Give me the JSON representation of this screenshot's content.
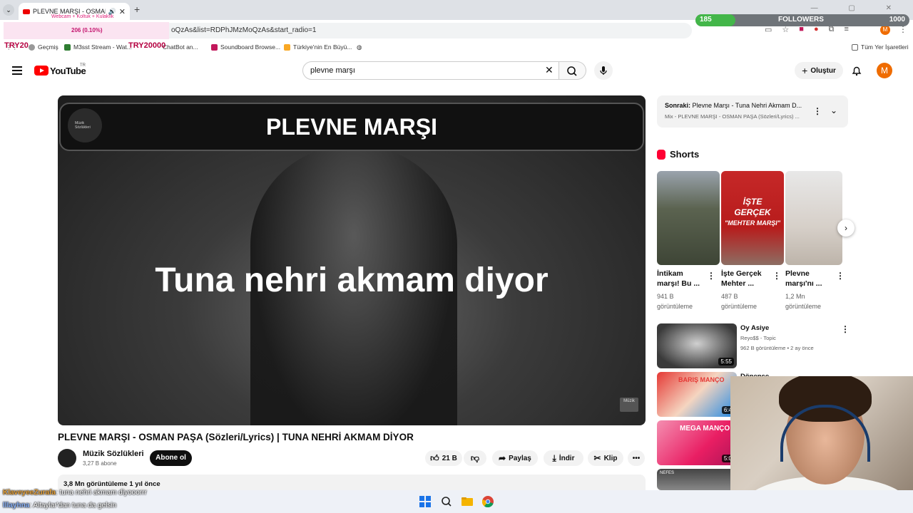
{
  "browser": {
    "tab_title": "PLEVNE MARŞI - OSMAN P",
    "url_fragment": "oQzAs&list=RDPhJMzMoQzAs&start_radio=1",
    "bookmarks": [
      {
        "label": "Geçmiş",
        "color": "#888888"
      },
      {
        "label": "M3sst Stream - Wat...",
        "color": "#2e7d32"
      },
      {
        "label": "ChatBot an...",
        "color": "#d32f2f"
      },
      {
        "label": "Soundboard Browse...",
        "color": "#c2185b"
      },
      {
        "label": "Türkiye'nin En Büyü...",
        "color": "#f9a825"
      }
    ],
    "bookmarks_right": "Tüm Yer İşaretleri",
    "window_controls": "— ▢ ✕"
  },
  "overlay": {
    "webcam_line": "Webcam + Koltuk + Kulaklık",
    "webcam_pct": "206 (0.10%)",
    "try1": "TRY20",
    "try2": "TRY20000",
    "followers_current": "185",
    "followers_label": "FOLLOWERS",
    "followers_goal": "1000",
    "followers_progress": 0.185
  },
  "header": {
    "logo_text": "YouTube",
    "logo_country": "TR",
    "search_value": "plevne marşı",
    "create_label": "Oluştur",
    "avatar_letter": "M"
  },
  "video": {
    "overlay_title": "PLEVNE MARŞI",
    "lyric": "Tuna nehri akmam diyor",
    "badge": "Müzik Sözlükleri",
    "watermark": "Müzik",
    "title": "PLEVNE MARŞI - OSMAN PAŞA (Sözleri/Lyrics) | TUNA NEHRİ AKMAM DİYOR",
    "channel": "Müzik Sözlükleri",
    "subscribers": "3,27 B abone",
    "subscribe_label": "Abone ol",
    "likes": "21 B",
    "share_label": "Paylaş",
    "download_label": "İndir",
    "clip_label": "Klip",
    "stats": "3,8 Mn görüntüleme  1 yıl önce"
  },
  "sidebar": {
    "up_next_prefix": "Sonraki:",
    "up_next_title": "Plevne Marşı - Tuna Nehri Akmam D...",
    "up_next_sub": "Mix - PLEVNE MARŞI - OSMAN PAŞA (Sözleri/Lyrics) ...",
    "shorts_heading": "Shorts",
    "shorts": [
      {
        "title": "İntikam marşı! Bu ...",
        "views": "941 B görüntüleme"
      },
      {
        "title": "İşte Gerçek Mehter ...",
        "views": "487 B görüntüleme"
      },
      {
        "title": "Plevne marşı'nı ...",
        "views": "1,2 Mn görüntüleme"
      }
    ],
    "short2_overlay": [
      "İŞTE",
      "GERÇEK",
      "\"MEHTER MARŞI\""
    ],
    "recommended": [
      {
        "title": "Oy Asiye",
        "channel": "Reyo$$ - Topic",
        "meta": "962 B görüntüleme • 2 ay önce",
        "duration": "5:55"
      },
      {
        "title": "Dönence",
        "duration": "6:4"
      },
      {
        "title": "",
        "duration": "5:0"
      },
      {
        "title": "",
        "duration": ""
      }
    ],
    "rec2_overlay": "BARIŞ MANÇO",
    "rec3_overlay": "MEGA MANÇO",
    "rec4_overlay": "NEFES"
  },
  "chat": [
    {
      "user": "KlaveyeeZurafa",
      "message": ": tuna nehri akmam diyooorrr"
    },
    {
      "user": "lllayhna",
      "message": ": Altaylar'dan tuna da gelsin"
    }
  ]
}
